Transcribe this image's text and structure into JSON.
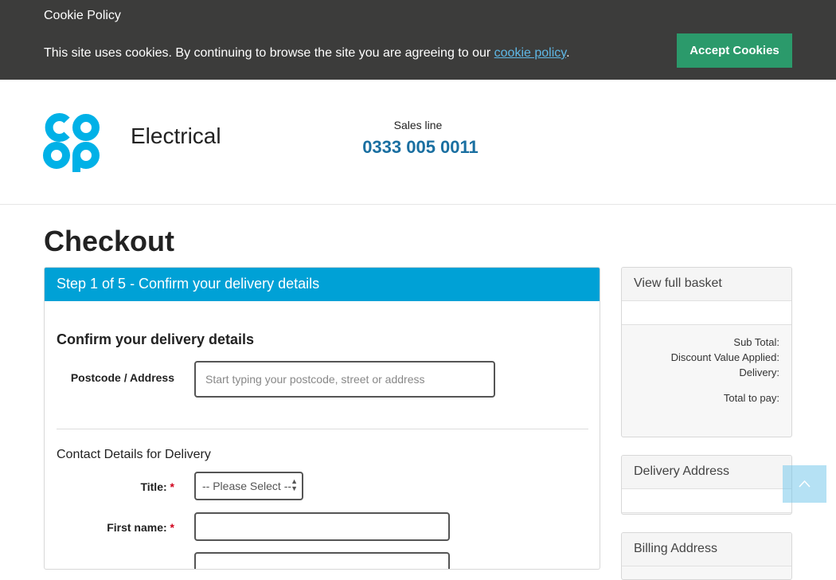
{
  "cookie": {
    "title": "Cookie Policy",
    "text": "This site uses cookies. By continuing to browse the site you are agreeing to our ",
    "link": "cookie policy",
    "period": ".",
    "accept_label": "Accept Cookies"
  },
  "header": {
    "brand": "Electrical",
    "sales_label": "Sales line",
    "sales_phone": "0333 005 0011"
  },
  "page": {
    "title": "Checkout"
  },
  "main": {
    "step": "Step 1 of 5 - Confirm your delivery details",
    "section_title": "Confirm your delivery details",
    "postcode_label": "Postcode / Address",
    "postcode_placeholder": "Start typing your postcode, street or address",
    "contact_heading": "Contact Details for Delivery",
    "title_label": "Title:",
    "title_select": "-- Please Select --",
    "first_name_label": "First name:",
    "required_mark": "*"
  },
  "sidebar": {
    "basket_heading": "View full basket",
    "sub_total": "Sub Total:",
    "discount": "Discount Value Applied:",
    "delivery": "Delivery:",
    "total": "Total to pay:",
    "delivery_address": "Delivery Address",
    "billing_address": "Billing Address"
  },
  "colors": {
    "banner": "#3c3c3b",
    "accept": "#2b9a6b",
    "step_bar": "#00a1d6",
    "phone": "#1a6fa1",
    "logo": "#00b1e7"
  }
}
